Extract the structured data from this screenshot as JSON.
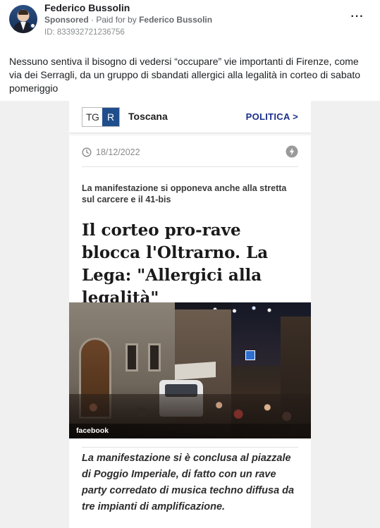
{
  "post": {
    "author": "Federico Bussolin",
    "sponsored_label": "Sponsored",
    "paid_prefix": "· Paid for by",
    "paid_by": "Federico Bussolin",
    "ad_id": "ID: 833932721236756",
    "more_icon": "···",
    "text": "Nessuno sentiva il bisogno di vedersi “occupare” vie importanti di Firenze, come via dei Serragli, da un gruppo di sbandati allergici alla legalità in corteo di sabato pomeriggio"
  },
  "article": {
    "logo_tg": "TG",
    "logo_r": "R",
    "region": "Toscana",
    "section": "POLITICA >",
    "date": "18/12/2022",
    "kicker": "La manifestazione si opponeva anche alla stretta sul carcere e il 41-bis",
    "headline": "Il corteo pro-rave blocca l'Oltrarno. La Lega: \"Allergici alla legalità\"",
    "photo_credit": "facebook",
    "summary": "La manifestazione si è conclusa al piazzale di Poggio Imperiale, di fatto con un rave party corredato di musica techno diffusa da tre impianti di amplificazione."
  },
  "colors": {
    "link_blue": "#1a2f8a",
    "tgr_blue": "#1f4e8c",
    "meta_gray": "#65676b"
  }
}
